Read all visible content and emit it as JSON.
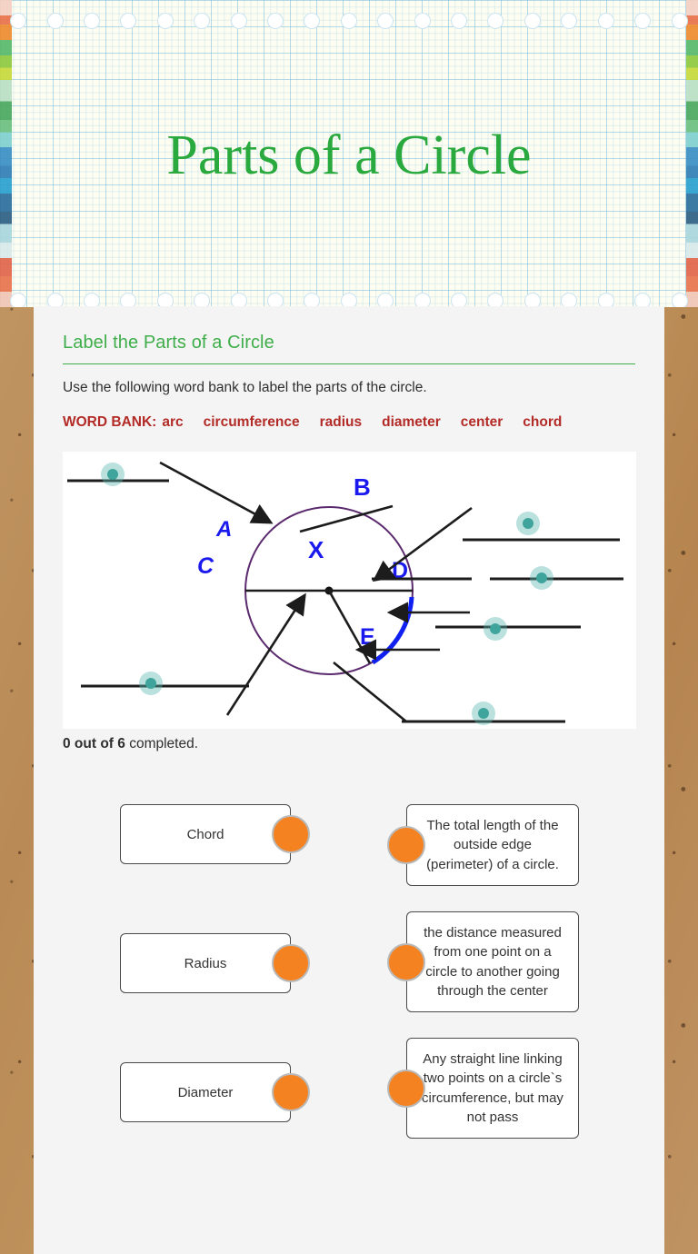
{
  "header": {
    "title": "Parts of a Circle",
    "title_color": "#2aa93f",
    "holes_count": 19
  },
  "section": {
    "title": "Label the Parts of a Circle",
    "title_color": "#3fae4a",
    "instructions": "Use the following word bank to label the parts of the circle.",
    "wordbank_label": "WORD BANK:",
    "wordbank_color": "#b32b27",
    "wordbank_words": [
      "arc",
      "circumference",
      "radius",
      "diameter",
      "center",
      "chord"
    ]
  },
  "diagram": {
    "circle_color": "#5b2a6e",
    "arc_color": "#1020f0",
    "label_color": "#1a1aee",
    "marker_color": "#5ab8b0",
    "point_labels": [
      "A",
      "B",
      "C",
      "D",
      "E",
      "X"
    ]
  },
  "progress": {
    "completed": "0 out of 6",
    "suffix": " completed."
  },
  "match": {
    "dot_color": "#f58220",
    "terms": [
      {
        "label": "Chord"
      },
      {
        "label": "Radius"
      },
      {
        "label": "Diameter"
      }
    ],
    "definitions": [
      {
        "text": "The total length of the outside edge (perimeter) of a circle."
      },
      {
        "text": "the distance measured from one point on a circle to another going through the center"
      },
      {
        "text": "Any straight line linking two points on a circle`s circumference, but may not pass"
      }
    ]
  }
}
